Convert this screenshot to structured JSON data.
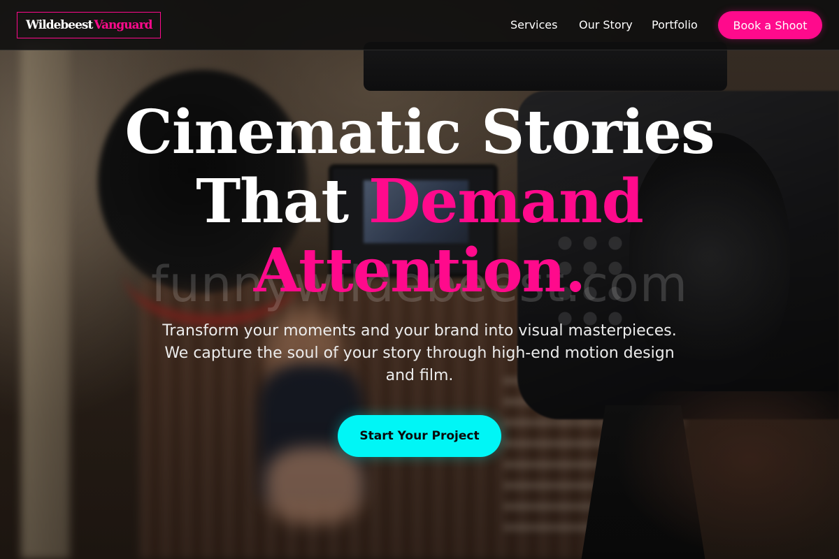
{
  "brand": {
    "part1": "Wildebeest",
    "part2": "Vanguard",
    "accent_color": "#ff0a8c"
  },
  "nav": {
    "links": [
      "Services",
      "Our Story",
      "Portfolio"
    ],
    "cta_label": "Book a Shoot"
  },
  "hero": {
    "title_line1": "Cinematic Stories",
    "title_line2_plain": "That ",
    "title_line2_highlight": "Demand",
    "title_line3_highlight": "Attention.",
    "subtitle": "Transform your moments and your brand into visual masterpieces. We capture the soul of your story through high-end motion design and film.",
    "cta_label": "Start Your Project",
    "cta_color": "#00f6f6"
  },
  "watermark": "funnywildebeest.com",
  "background_image": "blurred film set with professional video camera and monitor"
}
